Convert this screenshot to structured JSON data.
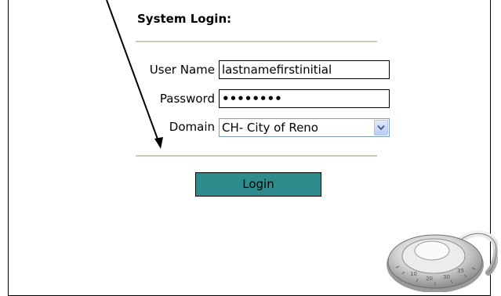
{
  "form": {
    "title": "System Login:",
    "username_label": "User Name",
    "username_value": "lastnamefirstinitial",
    "password_label": "Password",
    "password_value": "••••••••",
    "domain_label": "Domain",
    "domain_selected": "CH- City of Reno",
    "login_label": "Login"
  },
  "colors": {
    "login_button": "#2f8c8c",
    "rule": "#c9c9b4",
    "select_border": "#7f9db9"
  },
  "icons": [
    "chevron-down-icon",
    "combination-lock-icon",
    "annotation-arrow"
  ]
}
